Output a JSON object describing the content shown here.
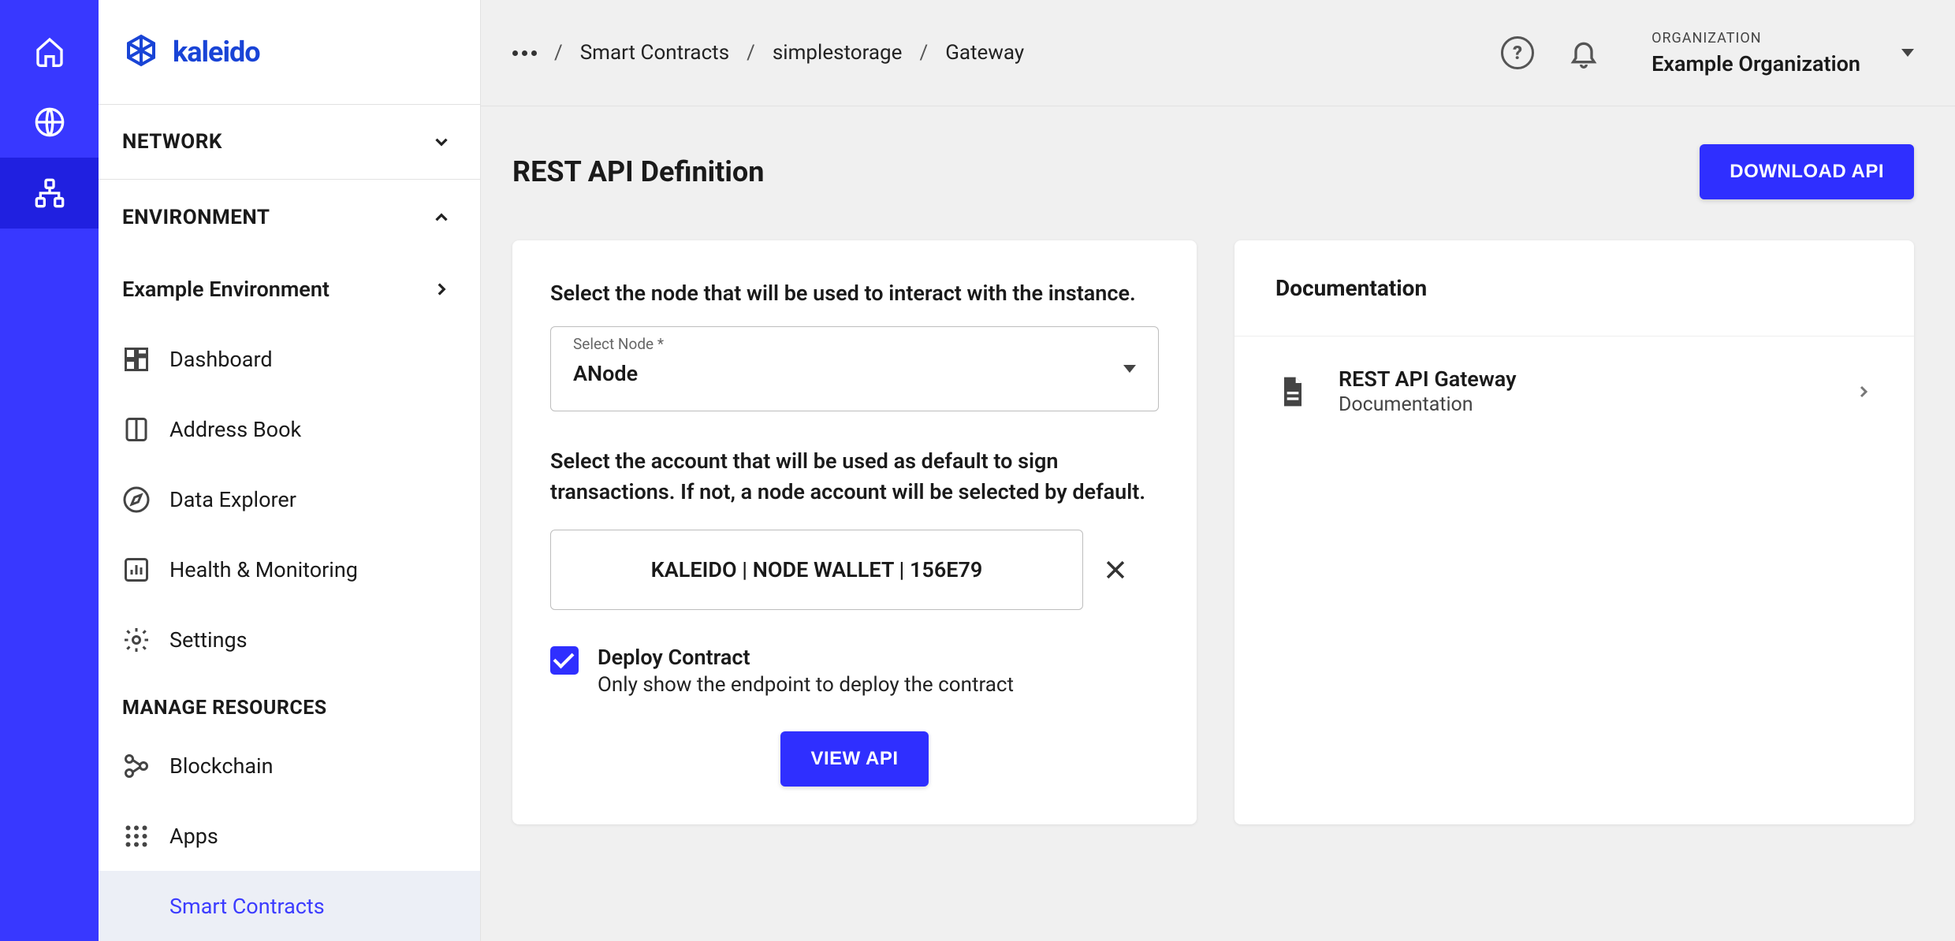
{
  "brand": "kaleido",
  "sidebar": {
    "network_label": "NETWORK",
    "environment_label": "ENVIRONMENT",
    "env_name": "Example Environment",
    "items": [
      {
        "label": "Dashboard"
      },
      {
        "label": "Address Book"
      },
      {
        "label": "Data Explorer"
      },
      {
        "label": "Health & Monitoring"
      },
      {
        "label": "Settings"
      }
    ],
    "manage_label": "MANAGE RESOURCES",
    "manage_items": [
      {
        "label": "Blockchain"
      },
      {
        "label": "Apps"
      },
      {
        "label": "Smart Contracts"
      }
    ]
  },
  "breadcrumbs": {
    "items": [
      "Smart Contracts",
      "simplestorage",
      "Gateway"
    ]
  },
  "org": {
    "caption": "ORGANIZATION",
    "value": "Example Organization"
  },
  "page": {
    "title": "REST API Definition",
    "download_btn": "DOWNLOAD API"
  },
  "form": {
    "node_instr": "Select the node that will be used to interact with the instance.",
    "node_label": "Select Node *",
    "node_value": "ANode",
    "account_instr": "Select the account that will be used as default to sign transactions. If not, a node account will be selected by default.",
    "account_value": "KALEIDO | NODE WALLET | 156E79",
    "deploy_title": "Deploy Contract",
    "deploy_sub": "Only show the endpoint to deploy the contract",
    "view_btn": "VIEW API"
  },
  "docs": {
    "header": "Documentation",
    "item_title": "REST API Gateway",
    "item_sub": "Documentation"
  }
}
